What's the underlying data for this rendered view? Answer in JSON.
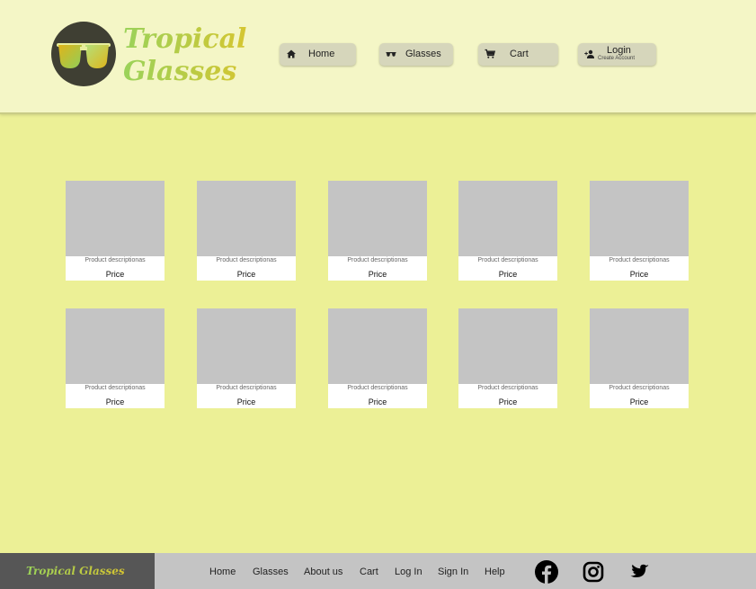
{
  "brand": {
    "title_line1": "Tropical",
    "title_line2": "Glasses"
  },
  "nav": {
    "home": "Home",
    "glasses": "Glasses",
    "cart": "Cart",
    "login": "Login",
    "create_account": "Create Account"
  },
  "products": [
    {
      "description": "Product descriptionas",
      "price": "Price"
    },
    {
      "description": "Product descriptionas",
      "price": "Price"
    },
    {
      "description": "Product descriptionas",
      "price": "Price"
    },
    {
      "description": "Product descriptionas",
      "price": "Price"
    },
    {
      "description": "Product descriptionas",
      "price": "Price"
    },
    {
      "description": "Product descriptionas",
      "price": "Price"
    },
    {
      "description": "Product descriptionas",
      "price": "Price"
    },
    {
      "description": "Product descriptionas",
      "price": "Price"
    },
    {
      "description": "Product descriptionas",
      "price": "Price"
    },
    {
      "description": "Product descriptionas",
      "price": "Price"
    }
  ],
  "footer": {
    "brand": "Tropical Glasses",
    "links": [
      "Home",
      "Glasses",
      "About us",
      "Cart",
      "Log In",
      "Sign In",
      "Help"
    ],
    "social_icons": [
      "facebook-icon",
      "instagram-icon",
      "twitter-icon"
    ]
  },
  "colors": {
    "page_bg": "#ecf096",
    "header_bg": "#f4f6c6",
    "button_bg": "#d6d6bb",
    "footer_bg": "#c4c4c4",
    "footer_brand_bg": "#565656",
    "placeholder_image": "#c4c4c4",
    "brand_green": "#9ad25a",
    "brand_yellow": "#d6c530"
  }
}
